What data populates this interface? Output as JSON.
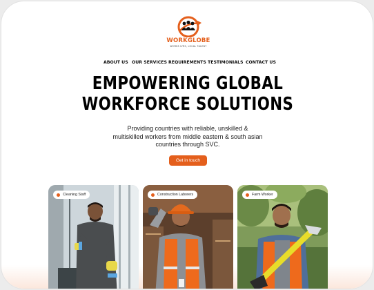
{
  "brand": {
    "name": "WORKGLOBE",
    "tagline": "WORKS IVRS, LOCAL TALENT",
    "accent_color": "#e45f1c"
  },
  "nav": {
    "items": [
      {
        "label": "ABOUT US"
      },
      {
        "label": "OUR SERVICES"
      },
      {
        "label": "REQUIREMENTS"
      },
      {
        "label": "TESTIMONIALS"
      },
      {
        "label": "CONTACT US"
      }
    ]
  },
  "hero": {
    "title_line1": "EMPOWERING GLOBAL",
    "title_line2": "WORKFORCE SOLUTIONS",
    "description_line1": "Providing countries with reliable, unskilled &",
    "description_line2": "multiskilled workers from middle eastern & south asian",
    "description_line3": "countries through SVC.",
    "cta_label": "Get in touch"
  },
  "cards": [
    {
      "label": "Cleaning Staff",
      "icon": "worker-photo-cleaning"
    },
    {
      "label": "Construction Laborers",
      "icon": "worker-photo-construction"
    },
    {
      "label": "Farm Worker",
      "icon": "worker-photo-farm"
    }
  ]
}
